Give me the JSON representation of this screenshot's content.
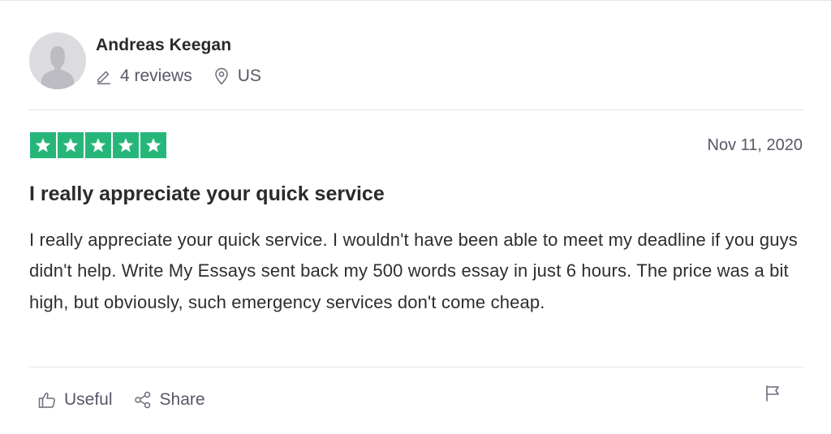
{
  "review": {
    "reviewer": {
      "name": "Andreas Keegan",
      "reviews_count": "4 reviews",
      "country": "US"
    },
    "rating": {
      "stars": 5,
      "max": 5,
      "color": "#27b67a"
    },
    "date": "Nov 11, 2020",
    "title": "I really appreciate your quick service",
    "body": "I really appreciate your quick service. I wouldn't have been able to meet my deadline if you guys didn't help. Write My Essays sent back my 500 words essay in just 6 hours. The price was a bit high, but obviously, such emergency services don't come cheap."
  },
  "actions": {
    "useful_label": "Useful",
    "share_label": "Share"
  },
  "icons": {
    "avatar": "user-silhouette-icon",
    "reviews": "pencil-icon",
    "location": "location-pin-icon",
    "star": "star-icon",
    "useful": "thumbs-up-icon",
    "share": "share-icon",
    "report": "flag-icon"
  }
}
